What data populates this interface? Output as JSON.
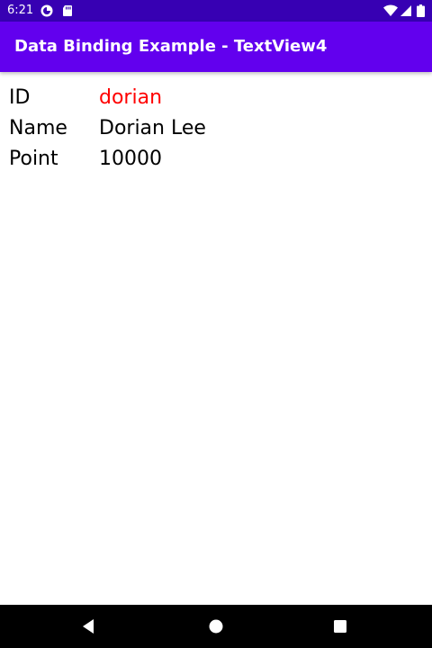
{
  "status_bar": {
    "time": "6:21",
    "background": "#3700b3",
    "left_icons": [
      "pocket-app-icon",
      "sd-card-icon"
    ],
    "right_icons": [
      "wifi-icon",
      "cell-signal-icon",
      "battery-icon"
    ]
  },
  "app_bar": {
    "title": "Data Binding Example - TextView4",
    "background": "#6200ee"
  },
  "fields": [
    {
      "label": "ID",
      "value": "dorian",
      "value_color": "#ff0000"
    },
    {
      "label": "Name",
      "value": "Dorian Lee",
      "value_color": "#000000"
    },
    {
      "label": "Point",
      "value": "10000",
      "value_color": "#000000"
    }
  ],
  "nav_bar": {
    "buttons": [
      "back-icon",
      "home-icon",
      "recents-icon"
    ]
  }
}
